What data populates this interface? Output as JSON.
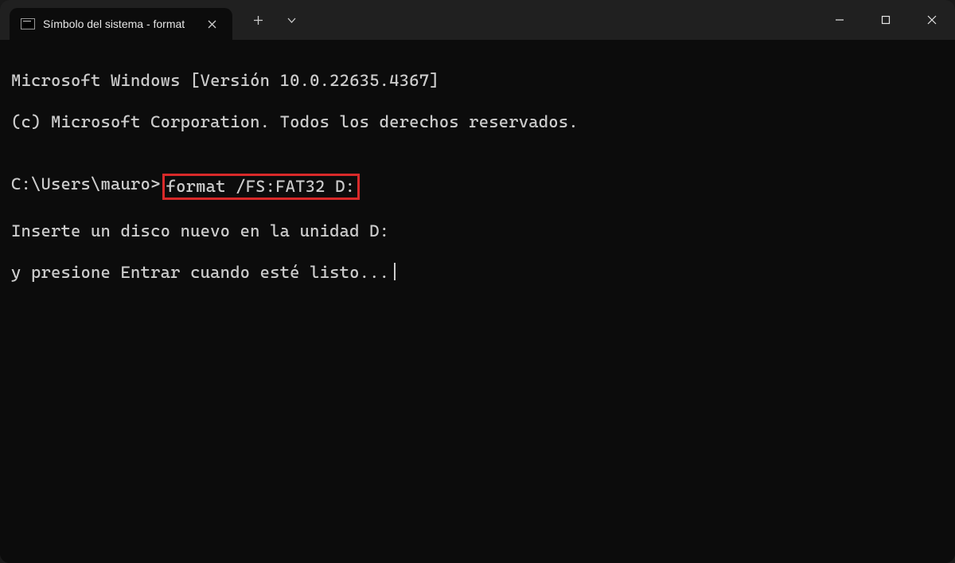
{
  "titlebar": {
    "tab_title": "Símbolo del sistema - format",
    "close_tab_glyph": "✕",
    "new_tab_glyph": "＋",
    "dropdown_glyph": "⌄",
    "minimize_glyph": "—",
    "maximize_glyph": "▢",
    "close_glyph": "✕"
  },
  "terminal": {
    "line1": "Microsoft Windows [Versión 10.0.22635.4367]",
    "line2": "(c) Microsoft Corporation. Todos los derechos reservados.",
    "blank": "",
    "prompt": "C:\\Users\\mauro>",
    "command": "format /FS:FAT32 D:",
    "line4": "Inserte un disco nuevo en la unidad D:",
    "line5": "y presione Entrar cuando esté listo..."
  }
}
